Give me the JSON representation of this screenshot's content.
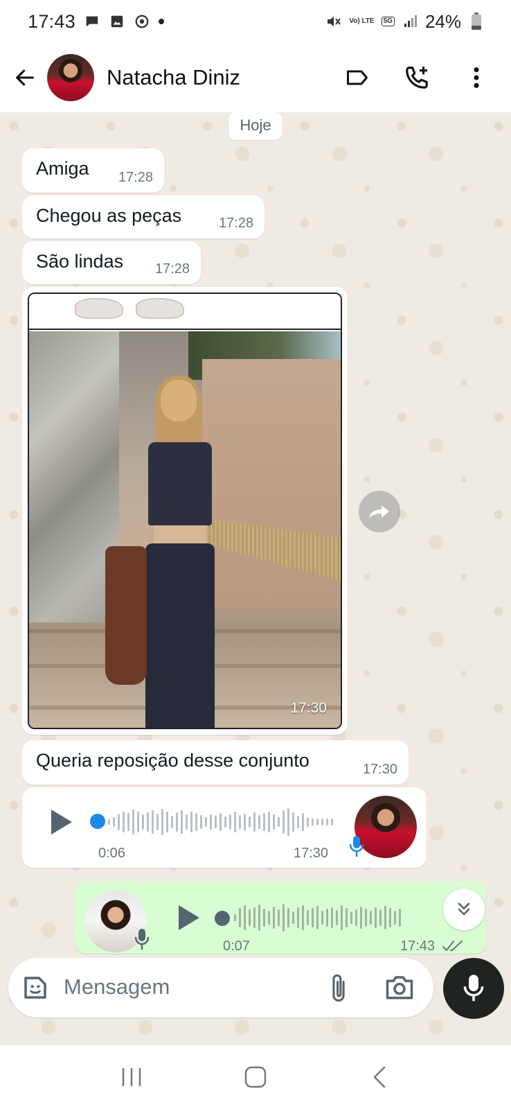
{
  "status_bar": {
    "time": "17:43",
    "battery": "24%",
    "network": "5G",
    "volte": "Vo) LTE"
  },
  "header": {
    "contact_name": "Natacha Diniz"
  },
  "chat": {
    "date_chip": "Hoje",
    "messages": [
      {
        "text": "Amiga",
        "time": "17:28"
      },
      {
        "text": "Chegou as peças",
        "time": "17:28"
      },
      {
        "text": "São lindas",
        "time": "17:28"
      },
      {
        "image_time": "17:30"
      },
      {
        "text": "Queria reposição desse conjunto",
        "time": "17:30"
      }
    ],
    "voice_incoming": {
      "duration": "0:06",
      "time": "17:30"
    },
    "voice_outgoing": {
      "duration": "0:07",
      "time": "17:43",
      "status": "read"
    }
  },
  "composer": {
    "placeholder": "Mensagem"
  },
  "colors": {
    "chat_bg": "#efeae2",
    "outgoing_bubble": "#d9fdd3",
    "incoming_bubble": "#ffffff",
    "accent_blue": "#1e88e5",
    "mic_fab": "#1f2421"
  }
}
